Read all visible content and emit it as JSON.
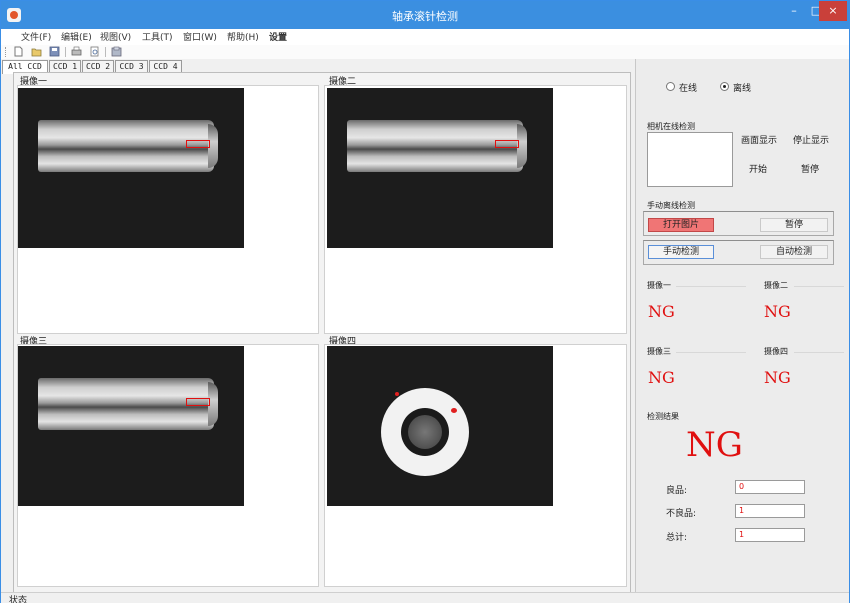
{
  "window": {
    "title": "轴承滚针检测",
    "controls": {
      "minimize": "–",
      "maximize": "□",
      "close": "×"
    }
  },
  "menu": [
    "文件(F)",
    "编辑(E)",
    "视图(V)",
    "工具(T)",
    "窗口(W)",
    "帮助(H)",
    "设置"
  ],
  "toolbar": [
    "new-icon",
    "open-icon",
    "save-icon",
    "print-icon",
    "print-preview-icon",
    "about-icon"
  ],
  "tabs": [
    "All CCD",
    "CCD 1",
    "CCD 2",
    "CCD 3",
    "CCD 4"
  ],
  "active_tab": "All CCD",
  "cameras": [
    {
      "label": "摄像一"
    },
    {
      "label": "摄像二"
    },
    {
      "label": "摄像三"
    },
    {
      "label": "摄像四"
    }
  ],
  "mode": {
    "online": "在线",
    "offline": "离线",
    "selected": "离线"
  },
  "camera_online": {
    "title": "相机在线检测",
    "display_button": "画面显示",
    "stop_display_button": "停止显示",
    "start_button": "开始",
    "pause_button": "暂停"
  },
  "manual_offline": {
    "title": "手动离线检测",
    "open_image_button": "打开图片",
    "pause_button": "暂停",
    "manual_detect_button": "手动检测",
    "auto_detect_button": "自动检测"
  },
  "results": [
    {
      "label": "摄像一",
      "value": "NG"
    },
    {
      "label": "摄像二",
      "value": "NG"
    },
    {
      "label": "摄像三",
      "value": "NG"
    },
    {
      "label": "摄像四",
      "value": "NG"
    }
  ],
  "detection_result": {
    "title": "检测结果",
    "value": "NG"
  },
  "counts": {
    "good_label": "良品:",
    "good_value": "0",
    "bad_label": "不良品:",
    "bad_value": "1",
    "total_label": "总计:",
    "total_value": "1"
  },
  "status": {
    "text": "状态"
  },
  "colors": {
    "titlebar": "#3b8fe0",
    "ng": "#e01010",
    "open_button": "#f07575"
  }
}
